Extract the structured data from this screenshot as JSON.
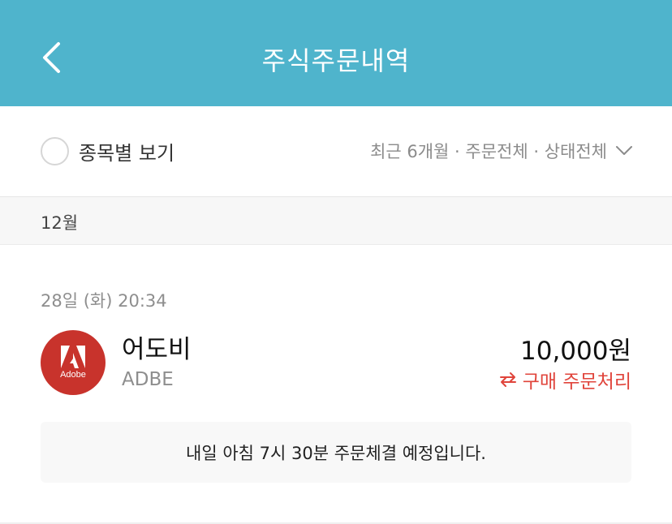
{
  "header": {
    "title": "주식주문내역",
    "back_icon": "chevron-left-icon"
  },
  "filter": {
    "view_by_stock_label": "종목별 보기",
    "summary": "최근 6개월 · 주문전체 · 상태전체",
    "dropdown_icon": "chevron-down-icon"
  },
  "month": {
    "label": "12월"
  },
  "orders": [
    {
      "datetime": "28일 (화) 20:34",
      "logo_text": "Adobe",
      "name": "어도비",
      "ticker": "ADBE",
      "amount": "10,000원",
      "status_icon": "repeat-icon",
      "status": "구매 주문처리",
      "notice": "내일 아침 7시 30분 주문체결 예정입니다."
    }
  ],
  "colors": {
    "header_bg": "#4fb4cc",
    "logo_bg": "#c8332c",
    "status_red": "#e0443b"
  }
}
